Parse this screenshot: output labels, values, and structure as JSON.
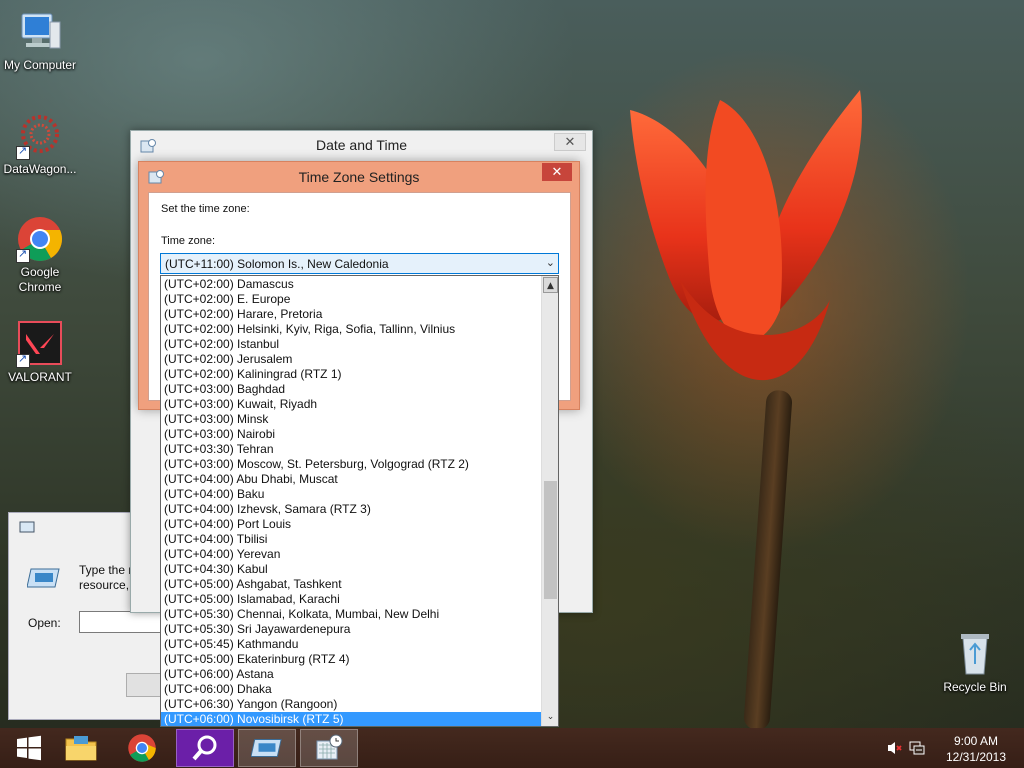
{
  "desktop": {
    "icons": [
      {
        "label": "My Computer"
      },
      {
        "label": "DataWagon..."
      },
      {
        "label": "Google Chrome"
      },
      {
        "label": "VALORANT"
      },
      {
        "label": "Recycle Bin"
      }
    ]
  },
  "date_time_window": {
    "title": "Date and Time",
    "close": "✕"
  },
  "timezone_window": {
    "title": "Time Zone Settings",
    "close": "✕",
    "set_label": "Set the time zone:",
    "zone_label": "Time zone:",
    "selected_value": "(UTC+11:00) Solomon Is., New Caledonia",
    "options": [
      "(UTC+02:00) Damascus",
      "(UTC+02:00) E. Europe",
      "(UTC+02:00) Harare, Pretoria",
      "(UTC+02:00) Helsinki, Kyiv, Riga, Sofia, Tallinn, Vilnius",
      "(UTC+02:00) Istanbul",
      "(UTC+02:00) Jerusalem",
      "(UTC+02:00) Kaliningrad (RTZ 1)",
      "(UTC+03:00) Baghdad",
      "(UTC+03:00) Kuwait, Riyadh",
      "(UTC+03:00) Minsk",
      "(UTC+03:00) Nairobi",
      "(UTC+03:30) Tehran",
      "(UTC+03:00) Moscow, St. Petersburg, Volgograd (RTZ 2)",
      "(UTC+04:00) Abu Dhabi, Muscat",
      "(UTC+04:00) Baku",
      "(UTC+04:00) Izhevsk, Samara (RTZ 3)",
      "(UTC+04:00) Port Louis",
      "(UTC+04:00) Tbilisi",
      "(UTC+04:00) Yerevan",
      "(UTC+04:30) Kabul",
      "(UTC+05:00) Ashgabat, Tashkent",
      "(UTC+05:00) Islamabad, Karachi",
      "(UTC+05:30) Chennai, Kolkata, Mumbai, New Delhi",
      "(UTC+05:30) Sri Jayawardenepura",
      "(UTC+05:45) Kathmandu",
      "(UTC+05:00) Ekaterinburg (RTZ 4)",
      "(UTC+06:00) Astana",
      "(UTC+06:00) Dhaka",
      "(UTC+06:30) Yangon (Rangoon)",
      "(UTC+06:00) Novosibirsk (RTZ 5)"
    ],
    "highlighted_index": 29
  },
  "run_dialog": {
    "description_line1": "Type the n",
    "description_line2": "resource,",
    "open_label": "Open:"
  },
  "taskbar": {
    "time": "9:00 AM",
    "date": "12/31/2013"
  },
  "colors": {
    "accent_select": "#3399ff",
    "tz_frame": "#f0a07e",
    "close_red": "#c7453b"
  }
}
